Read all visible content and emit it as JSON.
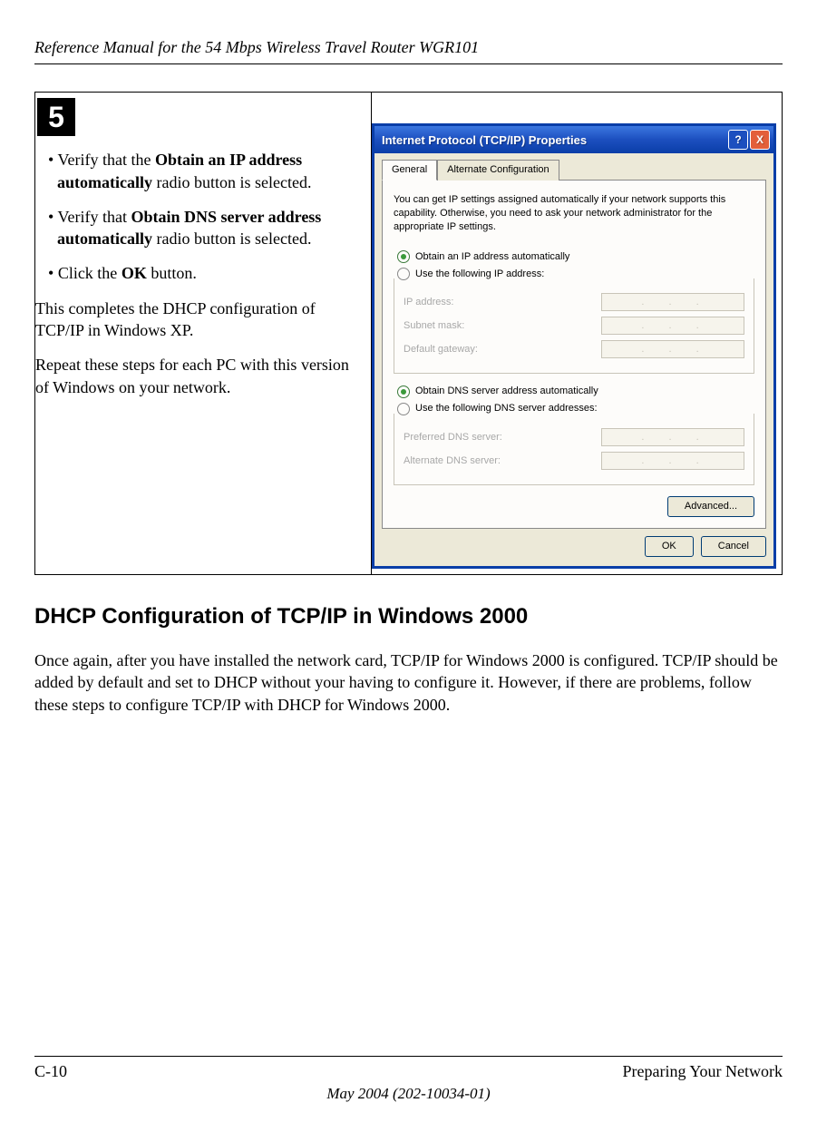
{
  "header": {
    "title": "Reference Manual for the 54 Mbps Wireless Travel Router WGR101"
  },
  "step": {
    "number": "5",
    "bullets": [
      {
        "pre": "Verify that the ",
        "bold": "Obtain an IP address automatically",
        "post": " radio button is selected."
      },
      {
        "pre": "Verify that ",
        "bold": "Obtain DNS server address automatically",
        "post": " radio button is selected."
      },
      {
        "pre": "Click the ",
        "bold": "OK",
        "post": " button."
      }
    ],
    "body1": "This completes the DHCP configuration of TCP/IP in Windows XP.",
    "body2": "Repeat these steps for each PC with this version of Windows on your network."
  },
  "dialog": {
    "title": "Internet Protocol (TCP/IP) Properties",
    "tabs": {
      "general": "General",
      "alt": "Alternate Configuration"
    },
    "info": "You can get IP settings assigned automatically if your network supports this capability. Otherwise, you need to ask your network administrator for the appropriate IP settings.",
    "r_obtain_ip": "Obtain an IP address automatically",
    "r_use_ip": "Use the following IP address:",
    "ip_address": "IP address:",
    "subnet": "Subnet mask:",
    "gateway": "Default gateway:",
    "r_obtain_dns": "Obtain DNS server address automatically",
    "r_use_dns": "Use the following DNS server addresses:",
    "pref_dns": "Preferred DNS server:",
    "alt_dns": "Alternate DNS server:",
    "advanced": "Advanced...",
    "ok": "OK",
    "cancel": "Cancel"
  },
  "section": {
    "heading": "DHCP Configuration of TCP/IP in Windows 2000",
    "para": "Once again, after you have installed the network card, TCP/IP for Windows 2000 is configured. TCP/IP should be added by default and set to DHCP without your having to configure it. However, if there are problems, follow these steps to configure TCP/IP with DHCP for Windows 2000."
  },
  "footer": {
    "page": "C-10",
    "section": "Preparing Your Network",
    "date": "May 2004 (202-10034-01)"
  }
}
